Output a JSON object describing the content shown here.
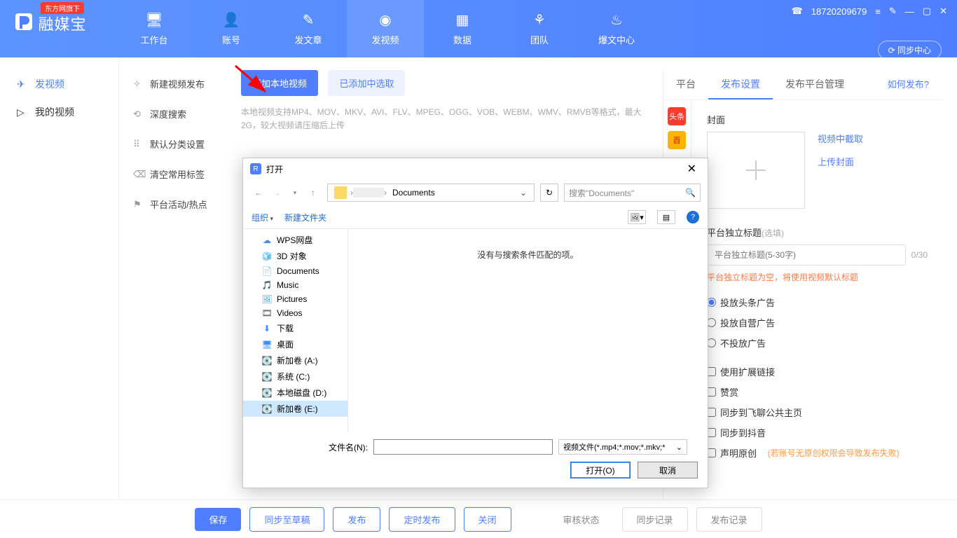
{
  "header": {
    "logo_badge": "东方网旗下",
    "logo_text": "融媒宝",
    "nav": [
      {
        "label": "工作台",
        "icon": "🖥"
      },
      {
        "label": "账号",
        "icon": "👤"
      },
      {
        "label": "发文章",
        "icon": "✎"
      },
      {
        "label": "发视频",
        "icon": "◉"
      },
      {
        "label": "数据",
        "icon": "▦"
      },
      {
        "label": "团队",
        "icon": "⚘"
      },
      {
        "label": "爆文中心",
        "icon": "♨"
      }
    ],
    "phone_icon": "☎",
    "phone": "18720209679",
    "sync_btn": "⟳ 同步中心",
    "menu_icon": "≡",
    "edit_icon": "✎",
    "min_icon": "—",
    "max_icon": "▢",
    "close_icon": "✕"
  },
  "left_menu": [
    {
      "label": "发视频",
      "icon": "✈"
    },
    {
      "label": "我的视频",
      "icon": "▷"
    }
  ],
  "sec_menu": [
    {
      "label": "新建视频发布",
      "icon": "✧"
    },
    {
      "label": "深度搜索",
      "icon": "⟲"
    },
    {
      "label": "默认分类设置",
      "icon": "⠿"
    },
    {
      "label": "清空常用标签",
      "icon": "⌫"
    },
    {
      "label": "平台活动/热点",
      "icon": "⚑"
    }
  ],
  "main": {
    "add_local": "添加本地视频",
    "select_added": "已添加中选取",
    "hint": "本地视频支持MP4、MOV、MKV、AVI、FLV、MPEG、OGG、VOB、WEBM、WMV、RMVB等格式，最大2G，较大视频请压缩后上传"
  },
  "right": {
    "tabs": [
      "平台",
      "发布设置",
      "发布平台管理"
    ],
    "how_link": "如何发布?",
    "platform_icons": [
      {
        "bg": "#ff3b30",
        "txt": "头条"
      },
      {
        "bg": "#ffb400",
        "txt": "百"
      }
    ],
    "cover_label": "封面",
    "cover_links": [
      "视频中截取",
      "上传封面"
    ],
    "title_label": "平台独立标题",
    "title_optional": "(选填)",
    "title_placeholder": "平台独立标题(5-30字)",
    "title_counter": "0/30",
    "title_warn": "平台独立标题为空，将使用视频默认标题",
    "ad_radios": [
      "投放头条广告",
      "投放自营广告",
      "不投放广告"
    ],
    "checks": [
      "使用扩展链接",
      "赞赏",
      "同步到飞聊公共主页",
      "同步到抖音",
      "声明原创"
    ],
    "orig_note": "(若账号无原创权限会导致发布失败)"
  },
  "bottom": {
    "save": "保存",
    "draft": "同步至草稿",
    "publish": "发布",
    "schedule": "定时发布",
    "close": "关闭",
    "audit": "审核状态",
    "sync_rec": "同步记录",
    "pub_rec": "发布记录"
  },
  "dialog": {
    "title": "打开",
    "path_seg": "Documents",
    "search_placeholder": "搜索\"Documents\"",
    "organize": "组织",
    "new_folder": "新建文件夹",
    "empty_msg": "没有与搜索条件匹配的项。",
    "tree": [
      {
        "icon": "☁",
        "color": "#3a8fff",
        "label": "WPS网盘"
      },
      {
        "icon": "🧊",
        "color": "#3aa0d8",
        "label": "3D 对象"
      },
      {
        "icon": "📄",
        "color": "#6aa0c8",
        "label": "Documents"
      },
      {
        "icon": "🎵",
        "color": "#3a8fff",
        "label": "Music"
      },
      {
        "icon": "🖼",
        "color": "#3aa0d8",
        "label": "Pictures"
      },
      {
        "icon": "🎞",
        "color": "#555",
        "label": "Videos"
      },
      {
        "icon": "⬇",
        "color": "#3a8fff",
        "label": "下载"
      },
      {
        "icon": "🖥",
        "color": "#3a8fff",
        "label": "桌面"
      },
      {
        "icon": "💽",
        "color": "#888",
        "label": "新加卷 (A:)"
      },
      {
        "icon": "💽",
        "color": "#888",
        "label": "系统 (C:)"
      },
      {
        "icon": "💽",
        "color": "#888",
        "label": "本地磁盘 (D:)"
      },
      {
        "icon": "💽",
        "color": "#888",
        "label": "新加卷 (E:)"
      }
    ],
    "filename_label": "文件名(N):",
    "filter": "视频文件(*.mp4;*.mov;*.mkv;*",
    "open_btn": "打开(O)",
    "cancel_btn": "取消"
  }
}
